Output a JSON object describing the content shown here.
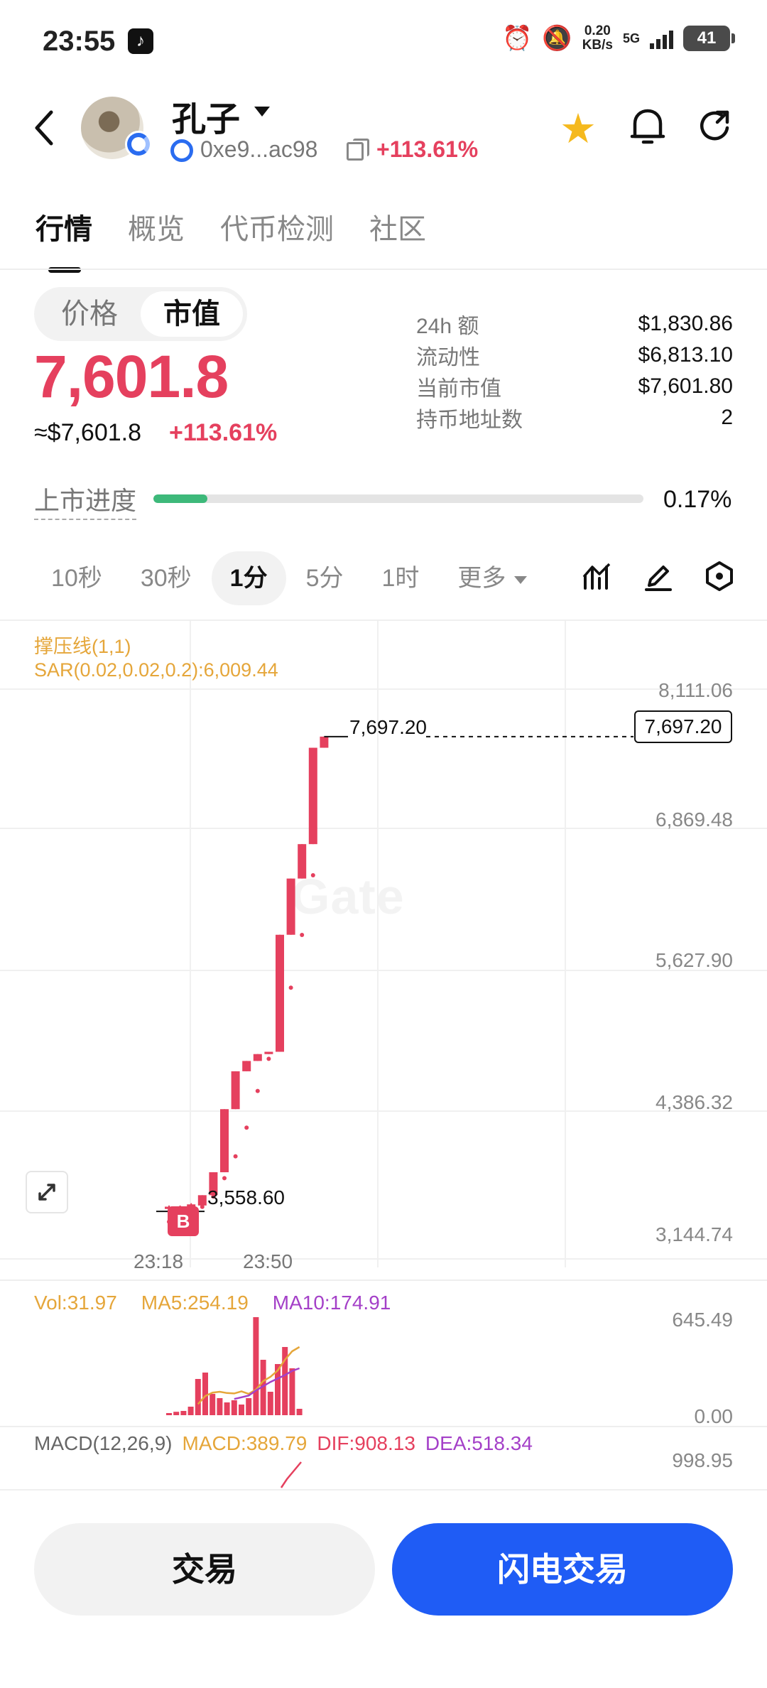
{
  "status_bar": {
    "time": "23:55",
    "net_speed_value": "0.20",
    "net_speed_unit": "KB/s",
    "network": "5G",
    "battery": "41"
  },
  "header": {
    "token_name": "孔子",
    "address": "0xe9...ac98",
    "change": "+113.61%"
  },
  "tabs": [
    {
      "label": "行情",
      "active": true
    },
    {
      "label": "概览",
      "active": false
    },
    {
      "label": "代币检测",
      "active": false
    },
    {
      "label": "社区",
      "active": false
    }
  ],
  "toggle": {
    "price": "价格",
    "market_cap": "市值",
    "selected": "市值"
  },
  "summary": {
    "value": "7,601.8",
    "usd_value": "≈$7,601.8",
    "change": "+113.61%"
  },
  "stats": [
    {
      "label": "24h  额",
      "value": "$1,830.86"
    },
    {
      "label": "流动性",
      "value": "$6,813.10"
    },
    {
      "label": "当前市值",
      "value": "$7,601.80"
    },
    {
      "label": "持币地址数",
      "value": "2"
    }
  ],
  "listing": {
    "label": "上市进度",
    "progress_text": "0.17%",
    "progress_fraction": 0.17
  },
  "intervals": [
    {
      "label": "10秒",
      "active": false
    },
    {
      "label": "30秒",
      "active": false
    },
    {
      "label": "1分",
      "active": true
    },
    {
      "label": "5分",
      "active": false
    },
    {
      "label": "1时",
      "active": false
    },
    {
      "label": "更多",
      "active": false
    }
  ],
  "chart": {
    "indicator_1": "撑压线(1,1)",
    "indicator_2": "SAR(0.02,0.02,0.2):6,009.44",
    "y_axis": [
      "8,111.06",
      "6,869.48",
      "5,627.90",
      "4,386.32",
      "3,144.74"
    ],
    "current_price_label": "7,697.20",
    "high_label": "7,697.20",
    "low_label": "3,558.60",
    "buy_marker": "B",
    "x_axis": [
      "23:18",
      "23:50"
    ],
    "watermark": "Gate",
    "volume": {
      "vol": "Vol:31.97",
      "ma5": "MA5:254.19",
      "ma10": "MA10:174.91",
      "axis_top": "645.49",
      "axis_bottom": "0.00"
    },
    "macd": {
      "title": "MACD(12,26,9)",
      "macd": "MACD:389.79",
      "dif": "DIF:908.13",
      "dea": "DEA:518.34",
      "axis_top": "998.95"
    },
    "colors": {
      "up": "#e5405e",
      "ma5": "#e5a63a",
      "ma10": "#a440c8",
      "grid": "#f0f0f0"
    }
  },
  "chart_data": {
    "type": "candlestick",
    "interval": "1分",
    "x_ticks": [
      "23:18",
      "23:50"
    ],
    "ylim": [
      3144.74,
      8111.06
    ],
    "candles": [
      {
        "open": 3580,
        "close": 3600,
        "high": 3610,
        "low": 3560
      },
      {
        "open": 3570,
        "close": 3600,
        "high": 3610,
        "low": 3560
      },
      {
        "open": 3590,
        "close": 3620,
        "high": 3630,
        "low": 3580
      },
      {
        "open": 3610,
        "close": 3700,
        "high": 3700,
        "low": 3600
      },
      {
        "open": 3700,
        "close": 3900,
        "high": 3900,
        "low": 3700
      },
      {
        "open": 3900,
        "close": 4450,
        "high": 4450,
        "low": 3900
      },
      {
        "open": 4450,
        "close": 4780,
        "high": 4780,
        "low": 4450
      },
      {
        "open": 4780,
        "close": 4870,
        "high": 4870,
        "low": 4780
      },
      {
        "open": 4870,
        "close": 4930,
        "high": 4930,
        "low": 4870
      },
      {
        "open": 4930,
        "close": 4950,
        "high": 4950,
        "low": 4930
      },
      {
        "open": 4950,
        "close": 5970,
        "high": 5970,
        "low": 4950
      },
      {
        "open": 5970,
        "close": 6460,
        "high": 6460,
        "low": 5970
      },
      {
        "open": 6460,
        "close": 6760,
        "high": 6760,
        "low": 6460
      },
      {
        "open": 6760,
        "close": 7600,
        "high": 7600,
        "low": 6760
      },
      {
        "open": 7600,
        "close": 7697.2,
        "high": 7697.2,
        "low": 7600
      }
    ],
    "sar": [
      3580,
      3600,
      3640,
      3710,
      3800,
      3960,
      4150,
      4400,
      4720,
      5000,
      5280,
      5620,
      6080,
      6600
    ],
    "volume": [
      5,
      8,
      10,
      20,
      85,
      100,
      50,
      40,
      30,
      35,
      25,
      40,
      230,
      130,
      55,
      120,
      160,
      110,
      15
    ],
    "ma5": [
      null,
      null,
      null,
      null,
      26,
      45,
      53,
      55,
      52,
      51,
      56,
      50,
      60,
      80,
      90,
      105,
      130,
      150,
      160
    ],
    "ma10": [
      null,
      null,
      null,
      null,
      null,
      null,
      null,
      null,
      null,
      38,
      42,
      46,
      58,
      68,
      78,
      86,
      94,
      104,
      110
    ]
  }
}
